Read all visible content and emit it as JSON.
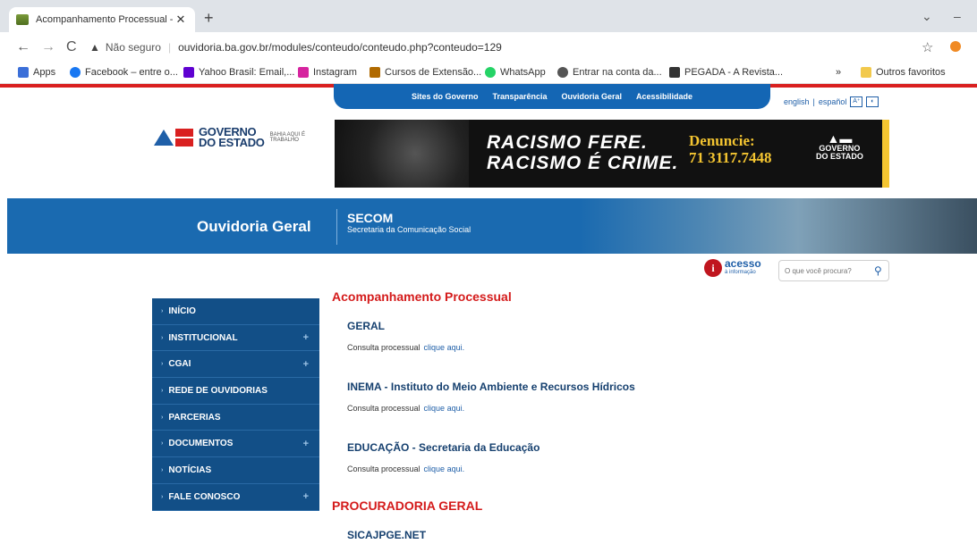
{
  "browser": {
    "tab_title": "Acompanhamento Processual - O",
    "tab_close": "✕",
    "new_tab": "+",
    "nav": {
      "back": "←",
      "forward": "→",
      "reload": "C"
    },
    "security_warning": "Não seguro",
    "url": "ouvidoria.ba.gov.br/modules/conteudo/conteudo.php?conteudo=129",
    "star": "☆",
    "bookmarks": [
      {
        "label": "Apps",
        "color": "#3b6fd8"
      },
      {
        "label": "Facebook – entre o...",
        "color": "#1877f2"
      },
      {
        "label": "Yahoo Brasil: Email,...",
        "color": "#5f01d1"
      },
      {
        "label": "Instagram",
        "color": "#d6249f"
      },
      {
        "label": "Cursos de Extensão...",
        "color": "#b06a00"
      },
      {
        "label": "WhatsApp",
        "color": "#25d366"
      },
      {
        "label": "Entrar na conta da...",
        "color": "#555555"
      },
      {
        "label": "PEGADA - A Revista...",
        "color": "#333333"
      }
    ],
    "bookmarks_more": "»",
    "other_favorites": "Outros favoritos"
  },
  "site": {
    "top_nav": [
      "Sites do Governo",
      "Transparência",
      "Ouvidoria Geral",
      "Acessibilidade"
    ],
    "lang_en": "english",
    "lang_sep": "|",
    "lang_es": "español",
    "logo": {
      "line1": "GOVERNO",
      "line2": "DO ESTADO",
      "tagline": "BAHIA AQUI É TRABALHO"
    },
    "banner": {
      "line1": "RACISMO FERE.",
      "line2": "RACISMO É CRIME.",
      "denuncie": "Denuncie:",
      "phone": "71 3117.7448",
      "logo_line1": "GOVERNO",
      "logo_line2": "DO ESTADO"
    },
    "header_title": "Ouvidoria Geral",
    "secom": "SECOM",
    "secom_sub": "Secretaria da Comunicação Social",
    "acesso": "acesso",
    "acesso_sub": "à informação",
    "search_placeholder": "O que você procura?",
    "menu": [
      {
        "label": "INÍCIO",
        "plus": ""
      },
      {
        "label": "INSTITUCIONAL",
        "plus": "+"
      },
      {
        "label": "CGAI",
        "plus": "+"
      },
      {
        "label": "REDE DE OUVIDORIAS",
        "plus": ""
      },
      {
        "label": "PARCERIAS",
        "plus": ""
      },
      {
        "label": "DOCUMENTOS",
        "plus": "+"
      },
      {
        "label": "NOTÍCIAS",
        "plus": ""
      },
      {
        "label": "FALE CONOSCO",
        "plus": "+"
      }
    ],
    "page_title": "Acompanhamento Processual",
    "sections": [
      {
        "title": "GERAL",
        "text": "Consulta processual",
        "link": "clique aqui."
      },
      {
        "title": "INEMA - Instituto do Meio Ambiente e Recursos Hídricos",
        "text": "Consulta processual",
        "link": "clique aqui."
      },
      {
        "title": "EDUCAÇÃO - Secretaria da Educação",
        "text": "Consulta processual",
        "link": "clique aqui."
      }
    ],
    "procuradoria": "PROCURADORIA GERAL",
    "sicajpge": "SICAJPGE.NET"
  }
}
